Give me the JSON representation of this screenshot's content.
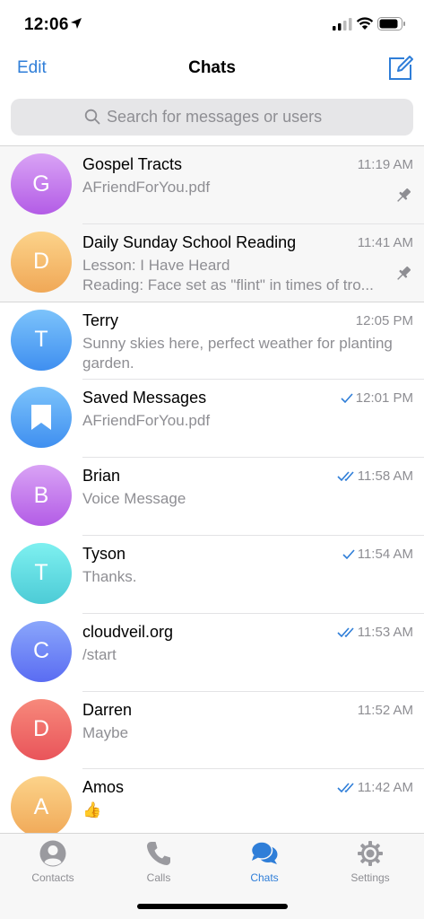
{
  "status_bar": {
    "time": "12:06"
  },
  "nav": {
    "edit": "Edit",
    "title": "Chats"
  },
  "search": {
    "placeholder": "Search for messages or users"
  },
  "colors": {
    "accent": "#2f7ed8",
    "secondary_text": "#8e8e93"
  },
  "chats": [
    {
      "name": "Gospel Tracts",
      "time": "11:19 AM",
      "preview": [
        "AFriendForYou.pdf"
      ],
      "initial": "G",
      "pinned": true,
      "status": "none",
      "avatar_color_top": "#d9a3f5",
      "avatar_color_bottom": "#b35ce6"
    },
    {
      "name": "Daily Sunday School Reading",
      "time": "11:41 AM",
      "preview": [
        "Lesson: I Have Heard",
        "Reading: Face set as \"flint\" in times of tro..."
      ],
      "initial": "D",
      "pinned": true,
      "status": "none",
      "avatar_color_top": "#fcd38a",
      "avatar_color_bottom": "#f0a857"
    },
    {
      "name": "Terry",
      "time": "12:05 PM",
      "preview": [
        "Sunny skies here, perfect weather for planting",
        "garden."
      ],
      "initial": "T",
      "pinned": false,
      "status": "none",
      "avatar_color_top": "#7cc3fb",
      "avatar_color_bottom": "#3f8ff0"
    },
    {
      "name": "Saved Messages",
      "time": "12:01 PM",
      "preview": [
        "AFriendForYou.pdf"
      ],
      "initial": "",
      "icon": "bookmark-icon",
      "pinned": false,
      "status": "sent",
      "avatar_color_top": "#7cc3fb",
      "avatar_color_bottom": "#3f8ff0"
    },
    {
      "name": "Brian",
      "time": "11:58 AM",
      "preview": [
        "Voice Message"
      ],
      "initial": "B",
      "pinned": false,
      "status": "read",
      "avatar_color_top": "#d9a3f5",
      "avatar_color_bottom": "#b35ce6"
    },
    {
      "name": "Tyson",
      "time": "11:54 AM",
      "preview": [
        "Thanks."
      ],
      "initial": "T",
      "pinned": false,
      "status": "sent",
      "avatar_color_top": "#7ef0f0",
      "avatar_color_bottom": "#4ccbd6"
    },
    {
      "name": "cloudveil.org",
      "time": "11:53 AM",
      "preview": [
        "/start"
      ],
      "initial": "C",
      "pinned": false,
      "status": "read",
      "avatar_color_top": "#8aa6fb",
      "avatar_color_bottom": "#5a6cf2"
    },
    {
      "name": "Darren",
      "time": "11:52 AM",
      "preview": [
        "Maybe"
      ],
      "initial": "D",
      "pinned": false,
      "status": "none",
      "avatar_color_top": "#f7897b",
      "avatar_color_bottom": "#e9545a"
    },
    {
      "name": "Amos",
      "time": "11:42 AM",
      "preview": [
        "👍"
      ],
      "initial": "A",
      "pinned": false,
      "status": "read",
      "avatar_color_top": "#fcd38a",
      "avatar_color_bottom": "#f0a857"
    }
  ],
  "tabs": [
    {
      "label": "Contacts",
      "icon": "contacts-icon",
      "active": false
    },
    {
      "label": "Calls",
      "icon": "phone-icon",
      "active": false
    },
    {
      "label": "Chats",
      "icon": "chats-icon",
      "active": true
    },
    {
      "label": "Settings",
      "icon": "gear-icon",
      "active": false
    }
  ]
}
